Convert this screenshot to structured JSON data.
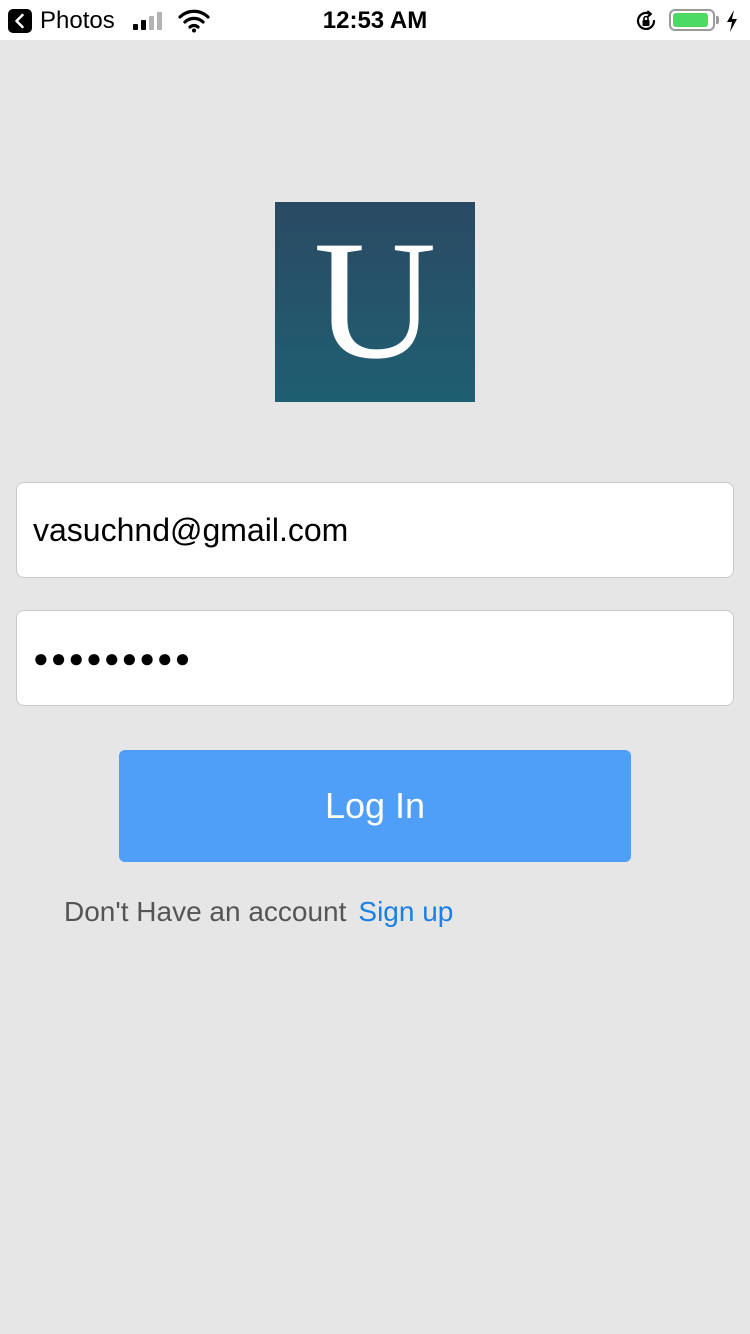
{
  "status_bar": {
    "back_app": "Photos",
    "time": "12:53 AM",
    "battery_level": 0.92,
    "battery_color": "#4cd964",
    "signal_bars_active": 2,
    "signal_bars_total": 4,
    "icons": [
      "back-arrow-icon",
      "signal-bars-icon",
      "wifi-icon",
      "orientation-lock-icon",
      "battery-icon",
      "charging-bolt-icon"
    ]
  },
  "logo": {
    "letter": "U",
    "gradient_top": "#2a4a63",
    "gradient_bottom": "#1f5f72"
  },
  "form": {
    "email_value": "vasuchnd@gmail.com",
    "password_masked": "●●●●●●●●●"
  },
  "login_button": {
    "label": "Log In",
    "color": "#4f9ef7"
  },
  "signup": {
    "prompt": "Don't Have an account",
    "link_label": "Sign up",
    "link_color": "#1a7fe6"
  }
}
